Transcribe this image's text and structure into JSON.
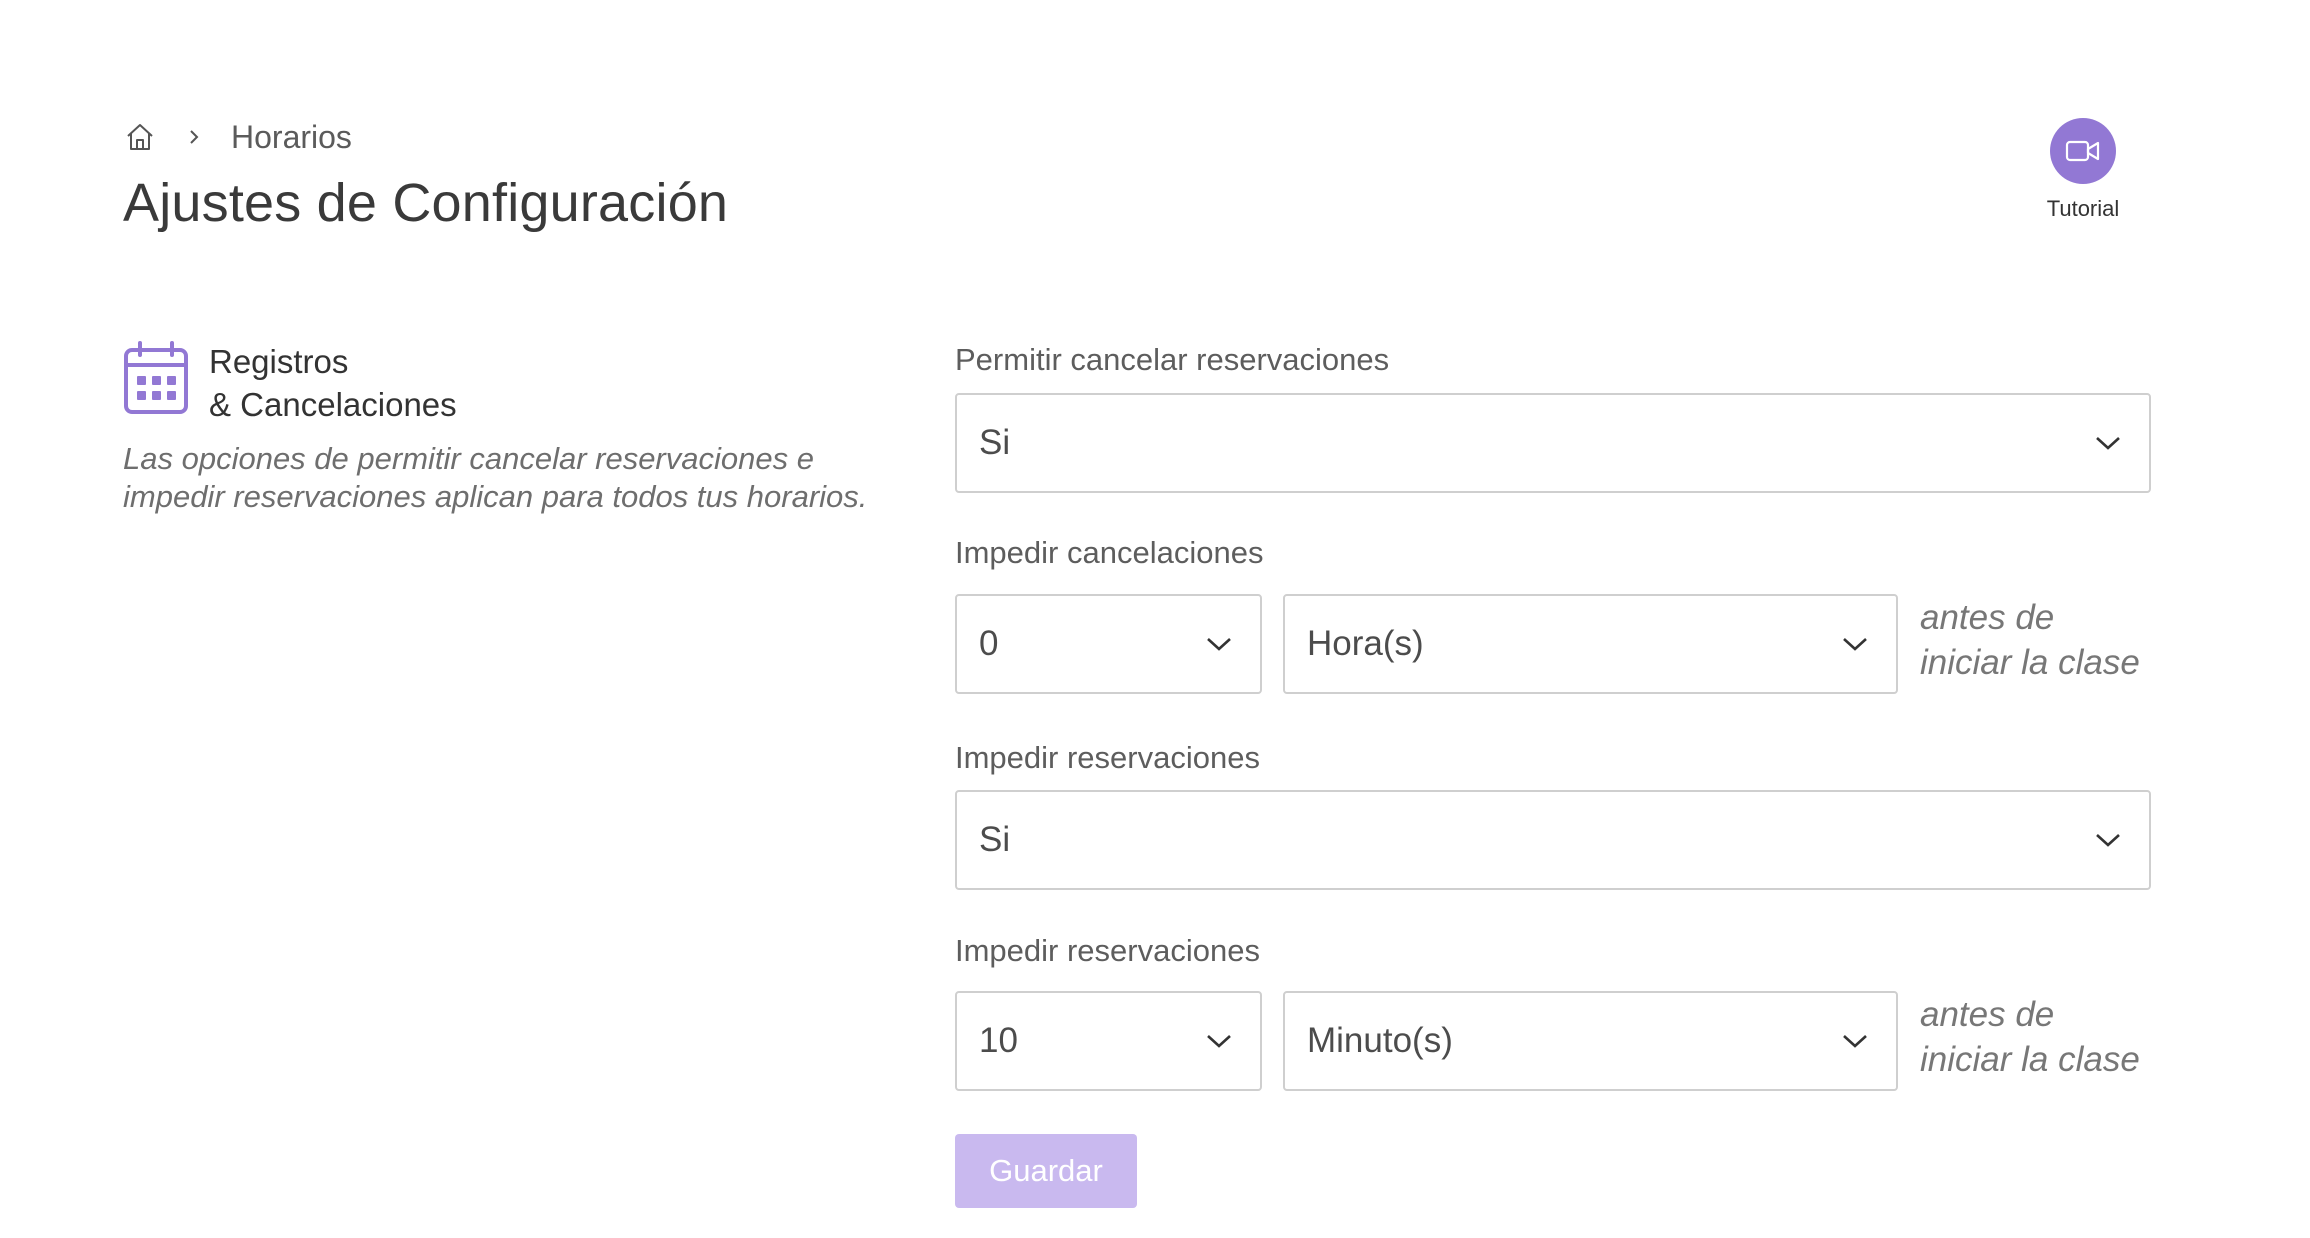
{
  "breadcrumb": {
    "current": "Horarios"
  },
  "header": {
    "title": "Ajustes de Configuración",
    "tutorial_label": "Tutorial"
  },
  "section": {
    "title_line1": "Registros",
    "title_line2": "& Cancelaciones",
    "description": "Las opciones de permitir cancelar reservaciones e impedir reservaciones aplican para todos tus horarios."
  },
  "form": {
    "allow_cancel": {
      "label": "Permitir cancelar reservaciones",
      "value": "Si"
    },
    "prevent_cancel": {
      "label": "Impedir cancelaciones",
      "amount": "0",
      "unit": "Hora(s)",
      "suffix_line1": "antes de",
      "suffix_line2": "iniciar la clase"
    },
    "prevent_booking": {
      "label": "Impedir reservaciones",
      "value": "Si"
    },
    "prevent_booking_time": {
      "label": "Impedir reservaciones",
      "amount": "10",
      "unit": "Minuto(s)",
      "suffix_line1": "antes de",
      "suffix_line2": "iniciar la clase"
    },
    "save_label": "Guardar"
  },
  "colors": {
    "accent": "#9278d4",
    "button_disabled": "#c9b9ef",
    "border": "#cfcfcf"
  }
}
